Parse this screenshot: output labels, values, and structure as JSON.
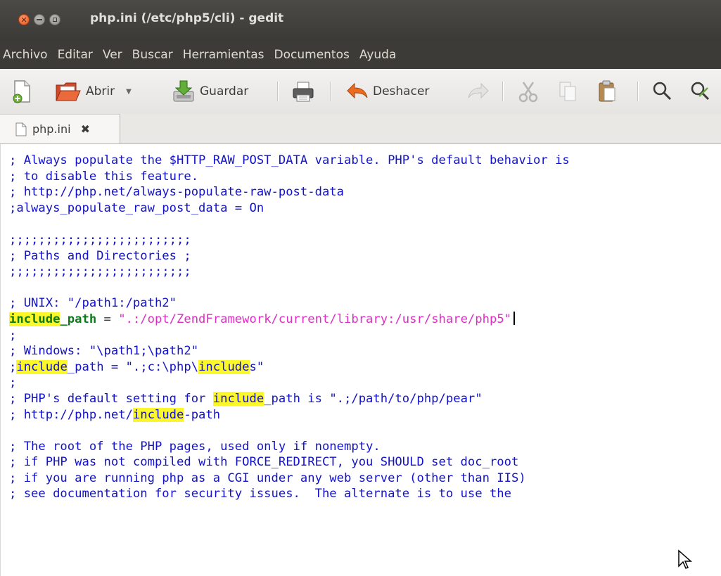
{
  "window": {
    "title": "php.ini (/etc/php5/cli) - gedit"
  },
  "menu": [
    "Archivo",
    "Editar",
    "Ver",
    "Buscar",
    "Herramientas",
    "Documentos",
    "Ayuda"
  ],
  "toolbar": {
    "open_label": "Abrir",
    "save_label": "Guardar",
    "undo_label": "Deshacer"
  },
  "tab": {
    "label": "php.ini"
  },
  "colors": {
    "comment": "#1313c9",
    "keyword": "#0c7a1a",
    "string": "#dc2fc2",
    "search_highlight": "#fcf72a"
  },
  "editor": {
    "lines": [
      [
        {
          "t": "; Always populate the $HTTP_RAW_POST_DATA variable. PHP's default behavior is",
          "c": "comment"
        }
      ],
      [
        {
          "t": "; to disable this feature.",
          "c": "comment"
        }
      ],
      [
        {
          "t": "; http://php.net/always-populate-raw-post-data",
          "c": "comment"
        }
      ],
      [
        {
          "t": ";always_populate_raw_post_data = On",
          "c": "comment"
        }
      ],
      [],
      [
        {
          "t": ";;;;;;;;;;;;;;;;;;;;;;;;;",
          "c": "comment"
        }
      ],
      [
        {
          "t": "; Paths and Directories ;",
          "c": "comment"
        }
      ],
      [
        {
          "t": ";;;;;;;;;;;;;;;;;;;;;;;;;",
          "c": "comment"
        }
      ],
      [],
      [
        {
          "t": "; UNIX: \"/path1:/path2\"",
          "c": "comment"
        }
      ],
      [
        {
          "t": "include",
          "c": "key hl"
        },
        {
          "t": "_path",
          "c": "key"
        },
        {
          "t": " = ",
          "c": "plain"
        },
        {
          "t": "\".:/opt/ZendFramework/current/library:/usr/share/php5\"",
          "c": "str"
        }
      ],
      [
        {
          "t": ";",
          "c": "comment"
        }
      ],
      [
        {
          "t": "; Windows: \"\\path1;\\path2\"",
          "c": "comment"
        }
      ],
      [
        {
          "t": ";",
          "c": "comment"
        },
        {
          "t": "include",
          "c": "comment hl"
        },
        {
          "t": "_path = \".;c:\\php\\",
          "c": "comment"
        },
        {
          "t": "include",
          "c": "comment hl"
        },
        {
          "t": "s\"",
          "c": "comment"
        }
      ],
      [
        {
          "t": ";",
          "c": "comment"
        }
      ],
      [
        {
          "t": "; PHP's default setting for ",
          "c": "comment"
        },
        {
          "t": "include",
          "c": "comment hl"
        },
        {
          "t": "_path is \".;/path/to/php/pear\"",
          "c": "comment"
        }
      ],
      [
        {
          "t": "; http://php.net/",
          "c": "comment"
        },
        {
          "t": "include",
          "c": "comment hl"
        },
        {
          "t": "-path",
          "c": "comment"
        }
      ],
      [],
      [
        {
          "t": "; The root of the PHP pages, used only if nonempty.",
          "c": "comment"
        }
      ],
      [
        {
          "t": "; if PHP was not compiled with FORCE_REDIRECT, you SHOULD set doc_root",
          "c": "comment"
        }
      ],
      [
        {
          "t": "; if you are running php as a CGI under any web server (other than IIS)",
          "c": "comment"
        }
      ],
      [
        {
          "t": "; see documentation for security issues.  The alternate is to use the",
          "c": "comment"
        }
      ]
    ]
  }
}
